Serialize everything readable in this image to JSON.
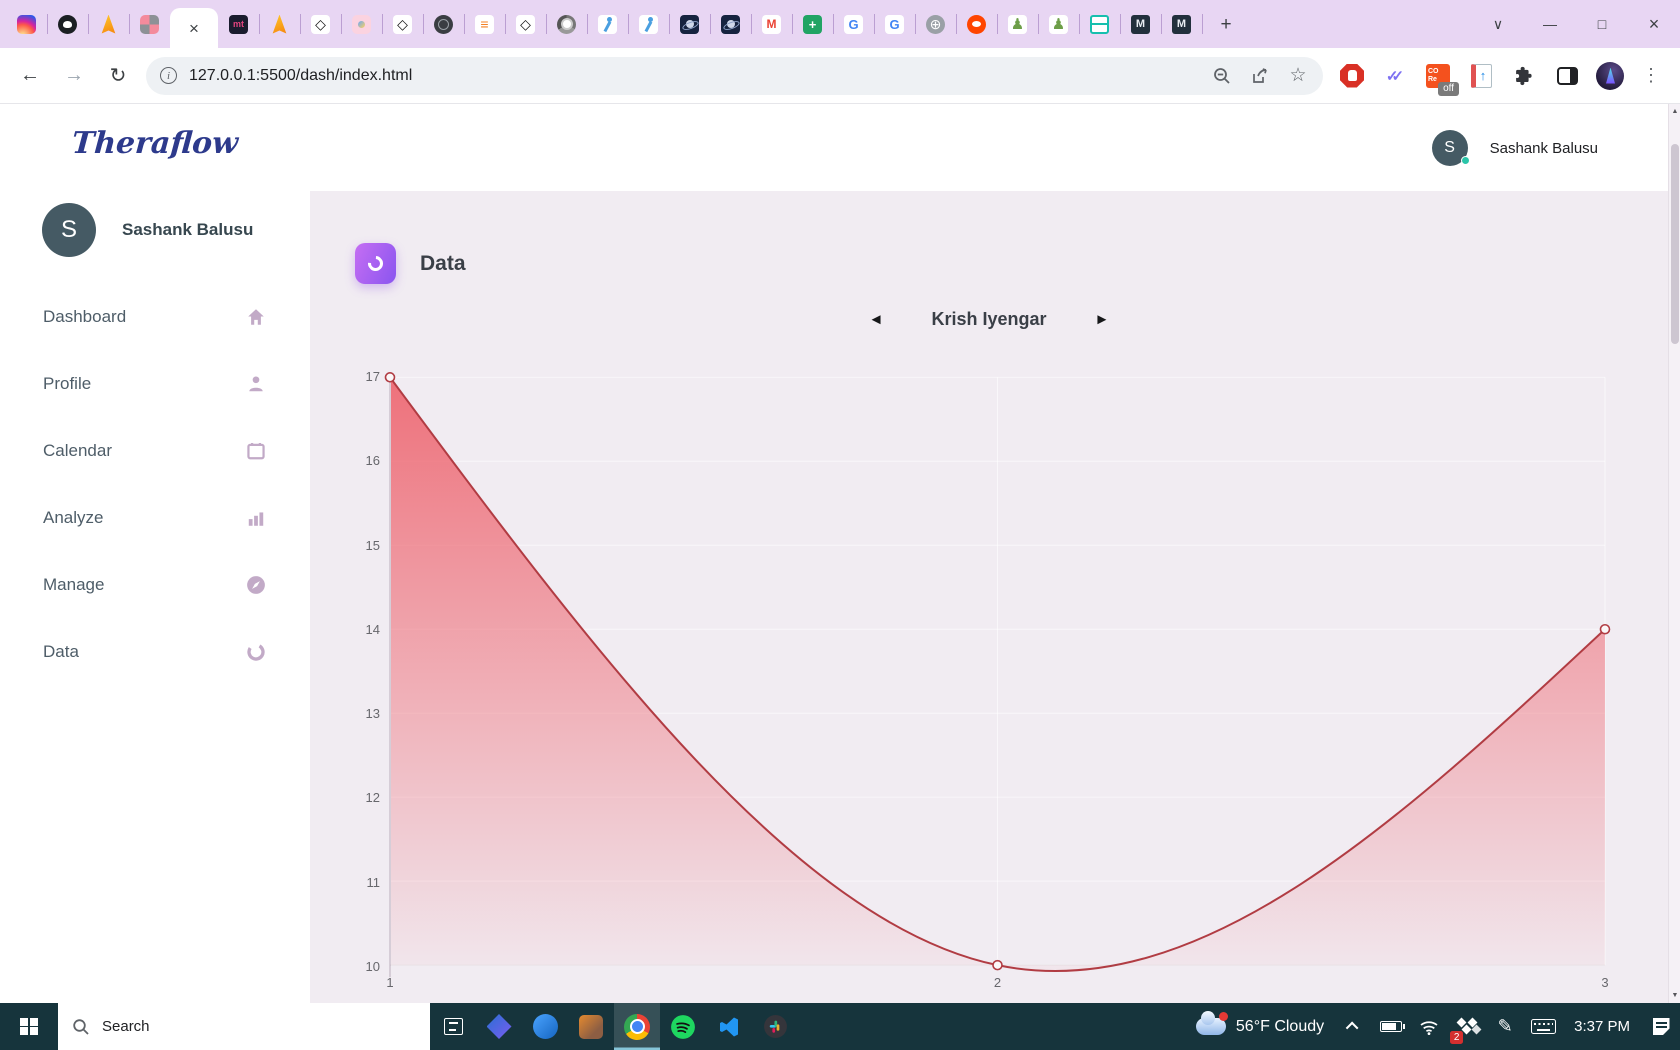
{
  "browser": {
    "tabs": [
      {
        "name": "instagram"
      },
      {
        "name": "github"
      },
      {
        "name": "firebase"
      },
      {
        "name": "grid-app"
      },
      {
        "name": "active",
        "glyph": "×"
      },
      {
        "name": "monkeytype",
        "glyph": "mt"
      },
      {
        "name": "firebase"
      },
      {
        "name": "cube",
        "glyph": "◇"
      },
      {
        "name": "pink-app"
      },
      {
        "name": "cube",
        "glyph": "◇"
      },
      {
        "name": "dark-globe"
      },
      {
        "name": "stackoverflow",
        "glyph": "≡"
      },
      {
        "name": "cube",
        "glyph": "◇"
      },
      {
        "name": "chrome-gray"
      },
      {
        "name": "person-blue"
      },
      {
        "name": "person-blue"
      },
      {
        "name": "space"
      },
      {
        "name": "space"
      },
      {
        "name": "gmail",
        "glyph": "M"
      },
      {
        "name": "green-cross",
        "glyph": "+"
      },
      {
        "name": "google",
        "glyph": "G"
      },
      {
        "name": "google",
        "glyph": "G"
      },
      {
        "name": "globe",
        "glyph": "⊕"
      },
      {
        "name": "reddit"
      },
      {
        "name": "chess-pawn",
        "glyph": "♟"
      },
      {
        "name": "chess-pawn",
        "glyph": "♟"
      },
      {
        "name": "teal-grid"
      },
      {
        "name": "m-dark",
        "glyph": "M"
      },
      {
        "name": "m-dark",
        "glyph": "M"
      },
      {
        "name": "new-tab",
        "glyph": "+"
      }
    ],
    "window_controls": {
      "menu": "∨",
      "minimize": "—",
      "maximize": "□",
      "close": "×"
    },
    "toolbar": {
      "back": "←",
      "forward": "→",
      "reload": "↻",
      "url": "127.0.0.1:5500/dash/index.html",
      "star": "☆"
    },
    "extensions": {
      "check_glyph": "✓✓",
      "core_line1": "CO",
      "core_line2": "Re",
      "core_badge": "off",
      "journal_glyph": "↑"
    },
    "menu_dots": "⋮"
  },
  "app": {
    "logo": "Theraflow",
    "user": {
      "initial": "S",
      "name": "Sashank Balusu"
    },
    "sidebar": {
      "items": [
        {
          "label": "Dashboard",
          "icon": "home-icon"
        },
        {
          "label": "Profile",
          "icon": "person-icon"
        },
        {
          "label": "Calendar",
          "icon": "calendar-icon"
        },
        {
          "label": "Analyze",
          "icon": "bar-chart-icon"
        },
        {
          "label": "Manage",
          "icon": "compass-icon"
        },
        {
          "label": "Data",
          "icon": "sync-ring-icon"
        }
      ]
    },
    "panel": {
      "title": "Data",
      "selector": {
        "prev": "◄",
        "name": "Krish Iyengar",
        "next": "►"
      }
    }
  },
  "chart_data": {
    "type": "line",
    "title": "Data",
    "series_label": "Krish Iyengar",
    "x": [
      1,
      2,
      3
    ],
    "series": [
      {
        "name": "Krish Iyengar",
        "values": [
          17,
          10,
          14
        ]
      }
    ],
    "xlim": [
      1,
      3
    ],
    "ylim": [
      10,
      17
    ],
    "yticks": [
      10,
      11,
      12,
      13,
      14,
      15,
      16,
      17
    ],
    "xticks": [
      1,
      2,
      3
    ],
    "grid": true,
    "smooth": "natural-cubic",
    "marker": "open-circle",
    "line_color": "#b13c43",
    "fill_top": "rgba(238,106,116,0.95)",
    "fill_bottom": "rgba(238,106,116,0.05)"
  },
  "taskbar": {
    "search_placeholder": "Search",
    "apps": [
      {
        "name": "task-view"
      },
      {
        "name": "app-blue-1"
      },
      {
        "name": "app-blue-2"
      },
      {
        "name": "app-amber"
      },
      {
        "name": "chrome",
        "active": true
      },
      {
        "name": "spotify"
      },
      {
        "name": "vscode"
      },
      {
        "name": "slack"
      }
    ],
    "weather": "56°F Cloudy",
    "badge_count": "2",
    "pen_glyph": "✎",
    "time": "3:37 PM"
  }
}
